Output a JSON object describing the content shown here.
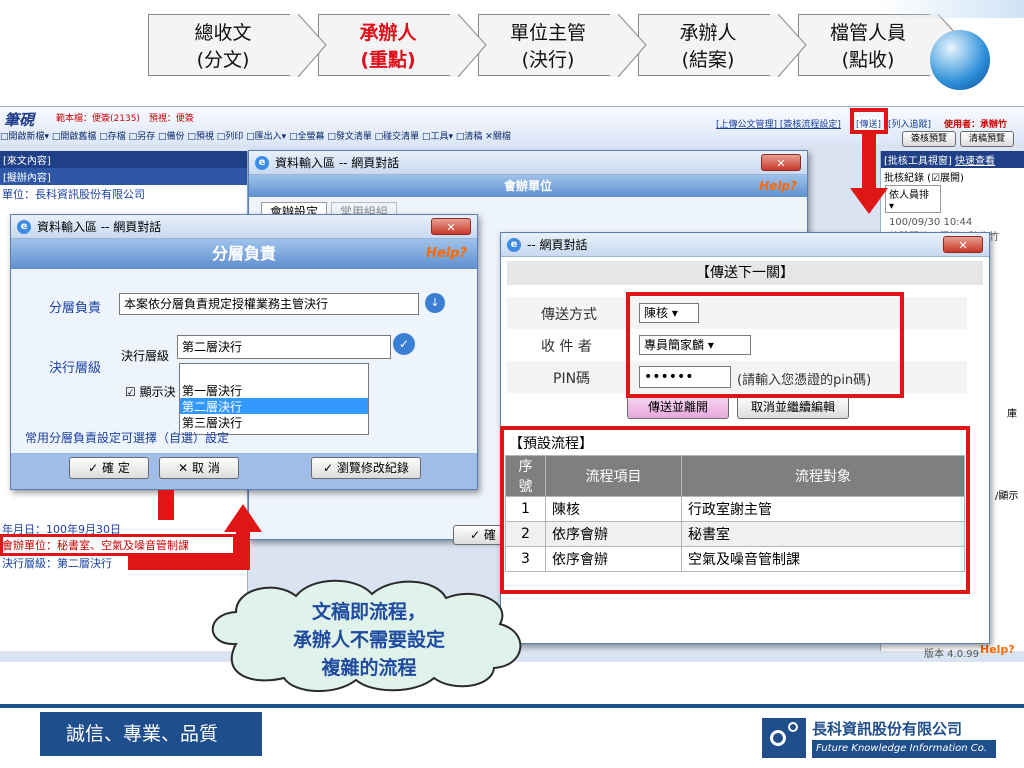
{
  "steps": [
    {
      "line1": "總收文",
      "line2": "(分文)",
      "hot": false
    },
    {
      "line1": "承辦人",
      "line2": "(重點)",
      "hot": true
    },
    {
      "line1": "單位主管",
      "line2": "(決行)",
      "hot": false
    },
    {
      "line1": "承辦人",
      "line2": "(結案)",
      "hot": false
    },
    {
      "line1": "檔管人員",
      "line2": "(點收)",
      "hot": false
    }
  ],
  "app": {
    "logo": "筆硯",
    "doc_info": "範本檔：便簽(2135)　預視：便簽",
    "menu": "□開啟新檔▾ □開啟舊檔 □存檔 □另存 □備份 □預視 □列印 □匯出入▾ □全螢幕 □發文清單 □碰交清單 □工具▾ □清稿 ✕關檔",
    "top_links": "[上傳公文管理] [簽核流程設定]",
    "send_link": "[傳送]",
    "join_link": "[列入追蹤]",
    "user": "使用者：承辦竹",
    "preview_btns": [
      "簽核預覽",
      "清稿預覽"
    ],
    "left_head": "[來文內容]",
    "left_sub": "[擬辦內容]",
    "left_unit": "單位：長科資訊股份有限公司",
    "left_date": "年月日：100年9月30日",
    "left_co": "會辦單位：秘書室、空氣及噪音管制課",
    "left_level": "決行層級：第二層決行",
    "right_head": "[批核工具視窗]",
    "right_link": "快速查看",
    "right_log": "批核紀錄 (☑展開)",
    "right_sel": "依人員排",
    "right_time": "100/09/30 10:44",
    "right_name": "軟體服務工程師：陳小竹",
    "right_side1": "庫",
    "right_side2": "/顯示",
    "status_ver": "版本 4.0.99",
    "status_help": "Help?"
  },
  "dlg_unit": {
    "title": "資料輸入區 -- 網頁對話",
    "bar": "會辦單位",
    "help": "Help?",
    "tabs": [
      "會辦設定",
      "常用組組"
    ],
    "confirm": "確"
  },
  "dlg_level": {
    "title": "資料輸入區 -- 網頁對話",
    "bar": "分層負責",
    "help": "Help?",
    "label_resp": "分層負責",
    "resp_value": "本案依分層負責規定授權業務主管決行",
    "label_level": "決行層級",
    "sub_label": "決行層級",
    "level_value": "第二層決行",
    "show_label": "☑ 顯示決",
    "options": [
      "第一層決行",
      "第二層決行",
      "第三層決行"
    ],
    "common_text": "常用分層負責設定可選擇（自選）設定",
    "ok": "確 定",
    "cancel": "取 消",
    "browse": "瀏覽修改紀錄"
  },
  "dlg_send": {
    "title": "-- 網頁對話",
    "header": "【傳送下一關】",
    "rows": [
      {
        "label": "傳送方式",
        "value": "陳核"
      },
      {
        "label": "收 件 者",
        "value": "專員簡家麟"
      },
      {
        "label": "PIN碼",
        "value": "••••••",
        "hint": "(請輸入您憑證的pin碼)"
      }
    ],
    "send_btn": "傳送並離開",
    "cancel_btn": "取消並繼續編輯",
    "flow_title": "【預設流程】",
    "flow_headers": [
      "序號",
      "流程項目",
      "流程對象"
    ],
    "flow_rows": [
      [
        "1",
        "陳核",
        "行政室謝主管"
      ],
      [
        "2",
        "依序會辦",
        "秘書室"
      ],
      [
        "3",
        "依序會辦",
        "空氣及噪音管制課"
      ]
    ]
  },
  "cloud": {
    "lines": [
      "文稿即流程，",
      "承辦人不需要設定",
      "複雜的流程"
    ]
  },
  "footer": {
    "slogan": "誠信、專業、品質",
    "company": "長科資訊股份有限公司",
    "company_en": "Future Knowledge Information Co."
  },
  "colors": {
    "accent_red": "#e01515",
    "footer_blue": "#1f4e8c"
  }
}
